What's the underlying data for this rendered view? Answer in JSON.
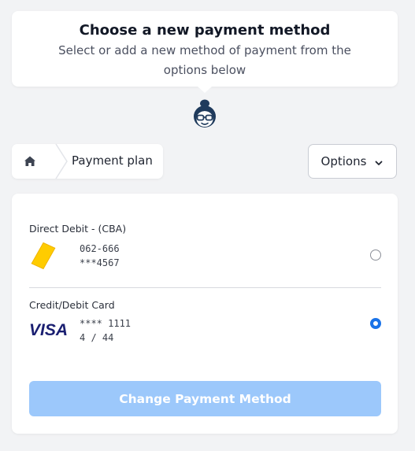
{
  "header": {
    "title": "Choose a new payment method",
    "subtitle": "Select or add a new method of payment from the options below"
  },
  "avatar_icon": "assistant-avatar-icon",
  "breadcrumb": {
    "home_icon": "home-icon",
    "current_label": "Payment plan"
  },
  "options": {
    "label": "Options",
    "icon": "chevron-down-icon"
  },
  "methods": [
    {
      "title": "Direct Debit - (CBA)",
      "logo_icon": "cba-logo-icon",
      "line1": "062-666",
      "line2": "***4567",
      "selected": false
    },
    {
      "title": "Credit/Debit Card",
      "logo_icon": "visa-logo-icon",
      "logo_text": "VISA",
      "line1": "**** 1111",
      "line2": "4 / 44",
      "selected": true
    }
  ],
  "submit": {
    "label": "Change Payment Method",
    "enabled": false
  },
  "colors": {
    "accent": "#1a73e8",
    "disabled_button": "#9cc8fb",
    "background": "#f2f3f5",
    "cba_yellow": "#ffcc00",
    "visa_blue": "#1a1f71"
  }
}
